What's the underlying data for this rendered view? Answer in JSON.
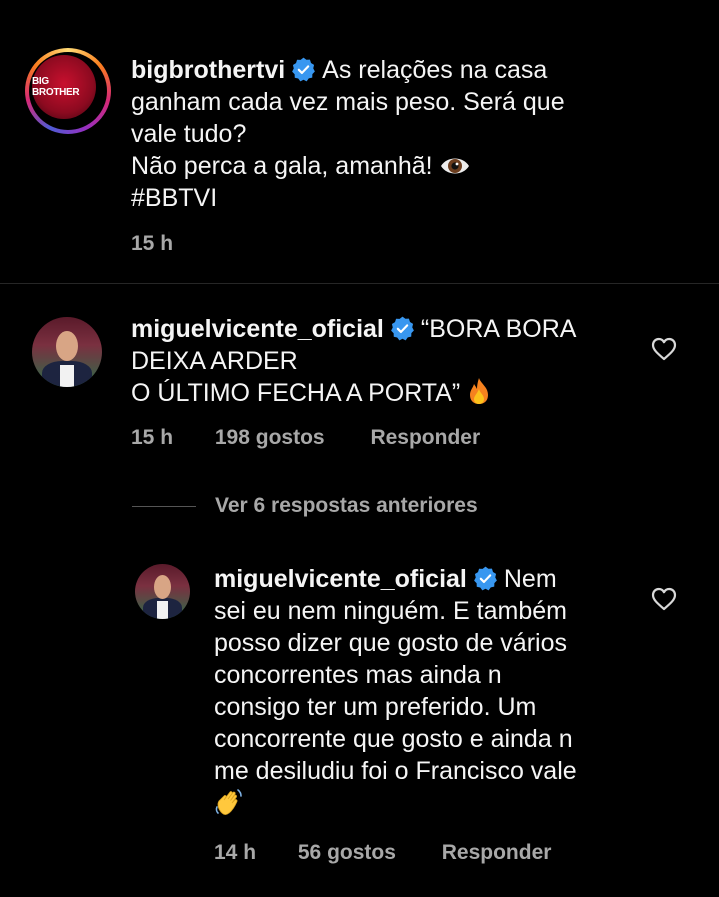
{
  "caption": {
    "username": "bigbrothertvi",
    "avatar_text": "BIG BROTHER",
    "lines": [
      "As relações na casa",
      "ganham cada vez mais peso. Será que",
      "vale tudo?",
      "Não perca a gala, amanhã!",
      "#BBTVI"
    ],
    "time": "15 h"
  },
  "comment": {
    "username": "miguelvicente_oficial",
    "lines": [
      "“BORA BORA",
      "DEIXA ARDER",
      "O ÚLTIMO FECHA A PORTA”"
    ],
    "time": "15 h",
    "likes": "198 gostos",
    "reply_label": "Responder"
  },
  "view_replies": "Ver 6 respostas anteriores",
  "reply": {
    "username": "miguelvicente_oficial",
    "lines": [
      "Nem",
      "sei eu nem ninguém. E também",
      "posso dizer que gosto de vários",
      "concorrentes mas ainda n",
      "consigo ter um preferido. Um",
      "concorrente que gosto e ainda n",
      "me desiludiu foi o Francisco vale"
    ],
    "time": "14 h",
    "likes": "56 gostos",
    "reply_label": "Responder"
  },
  "icons": {
    "verified": "verified-badge-icon",
    "eye": "eye-emoji-icon",
    "fire": "fire-emoji-icon",
    "wave": "waving-hand-emoji-icon",
    "heart": "heart-outline-icon"
  },
  "colors": {
    "background": "#000000",
    "text": "#f5f5f5",
    "muted": "#a8a8a8",
    "verified": "#3897f0"
  }
}
